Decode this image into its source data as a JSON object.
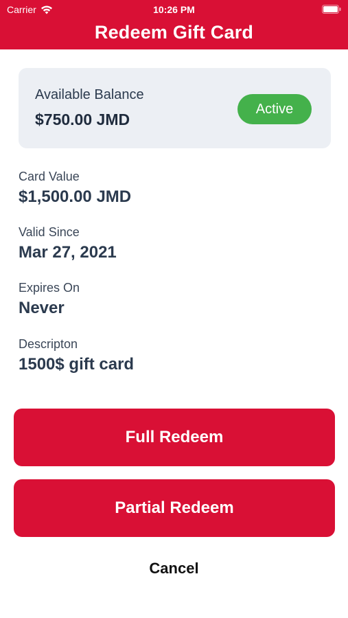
{
  "status_bar": {
    "carrier": "Carrier",
    "time": "10:26 PM",
    "wifi_icon": "wifi-icon",
    "battery_icon": "battery-icon"
  },
  "header": {
    "title": "Redeem Gift Card",
    "color": "#d91035"
  },
  "balance": {
    "label": "Available Balance",
    "value": "$750.00 JMD",
    "status": "Active",
    "status_color": "#44b14b"
  },
  "details": {
    "card_value_label": "Card Value",
    "card_value": "$1,500.00 JMD",
    "valid_since_label": "Valid Since",
    "valid_since": "Mar 27, 2021",
    "expires_label": "Expires On",
    "expires": "Never",
    "description_label": "Descripton",
    "description": "1500$ gift card"
  },
  "actions": {
    "full_redeem": "Full Redeem",
    "partial_redeem": "Partial Redeem",
    "cancel": "Cancel"
  }
}
